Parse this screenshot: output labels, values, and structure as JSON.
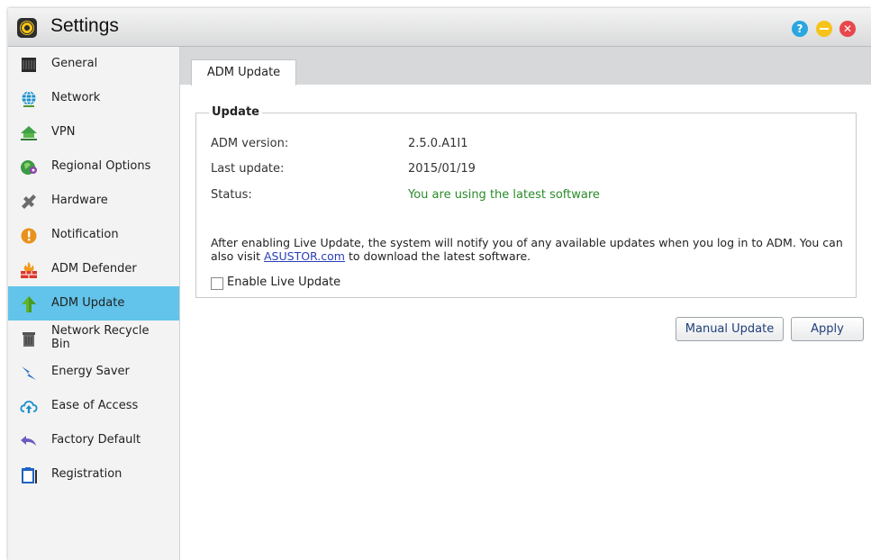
{
  "window": {
    "title": "Settings"
  },
  "title_buttons": {
    "help": "?",
    "close": "✕"
  },
  "sidebar": {
    "items": [
      {
        "label": "General",
        "icon": "server-icon"
      },
      {
        "label": "Network",
        "icon": "globe-icon"
      },
      {
        "label": "VPN",
        "icon": "house-network-icon"
      },
      {
        "label": "Regional Options",
        "icon": "globe-pin-icon"
      },
      {
        "label": "Hardware",
        "icon": "wrench-icon"
      },
      {
        "label": "Notification",
        "icon": "exclamation-icon"
      },
      {
        "label": "ADM Defender",
        "icon": "firewall-icon"
      },
      {
        "label": "ADM Update",
        "icon": "up-arrow-icon",
        "active": true
      },
      {
        "label": "Network Recycle Bin",
        "icon": "recycle-bin-icon"
      },
      {
        "label": "Energy Saver",
        "icon": "lightning-icon"
      },
      {
        "label": "Ease of Access",
        "icon": "cloud-upload-icon"
      },
      {
        "label": "Factory Default",
        "icon": "undo-arrow-icon"
      },
      {
        "label": "Registration",
        "icon": "clipboard-icon"
      }
    ]
  },
  "tabs": [
    {
      "label": "ADM Update",
      "active": true
    }
  ],
  "update": {
    "legend": "Update",
    "rows": [
      {
        "label": "ADM version:",
        "value": "2.5.0.A1I1"
      },
      {
        "label": "Last update:",
        "value": "2015/01/19"
      },
      {
        "label": "Status:",
        "value": "You are using the latest software"
      }
    ],
    "description_before": "After enabling Live Update, the system will notify you of any available updates when you log in to ADM. You can also visit ",
    "description_link": "ASUSTOR.com",
    "description_after": " to download the latest software.",
    "checkbox_label": "Enable Live Update",
    "checkbox_checked": false
  },
  "buttons": {
    "manual_update": "Manual Update",
    "apply": "Apply"
  },
  "colors": {
    "accent": "#62c4ea",
    "status_ok": "#2a8a2a",
    "link": "#2a3fb5"
  }
}
